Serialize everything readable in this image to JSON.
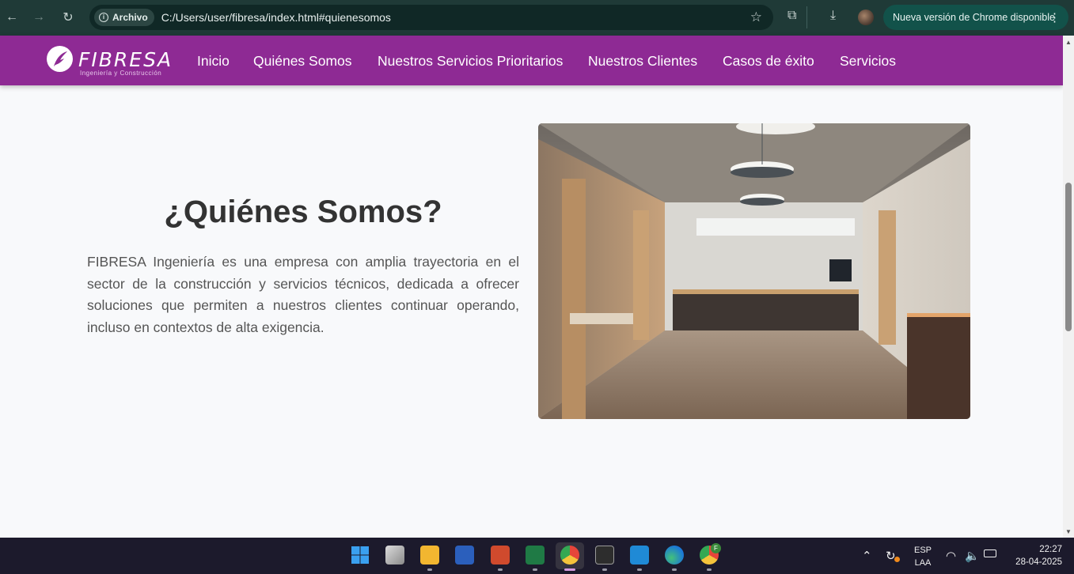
{
  "browser": {
    "site_chip": "Archivo",
    "url": "C:/Users/user/fibresa/index.html#quienesomos",
    "update_label": "Nueva versión de Chrome disponible"
  },
  "site": {
    "logo_word": "FIBRESA",
    "logo_sub": "Ingeniería y Construcción",
    "nav": [
      "Inicio",
      "Quiénes Somos",
      "Nuestros Servicios Prioritarios",
      "Nuestros Clientes",
      "Casos de éxito",
      "Servicios"
    ]
  },
  "about": {
    "heading": "¿Quiénes Somos?",
    "text": "FIBRESA Ingeniería es una empresa con amplia trayectoria en el sector de la construcción y servicios técnicos, dedicada a ofrecer soluciones que permiten a nuestros clientes continuar operando, incluso en contextos de alta exigencia."
  },
  "taskbar": {
    "language_top": "ESP",
    "language_bottom": "LAA",
    "time": "22:27",
    "date": "28-04-2025",
    "chrome_profile_badge": "F"
  },
  "colors": {
    "nav_bg": "#8e2a94",
    "chrome_bar": "#1f3a37",
    "update_pill": "#12524a"
  }
}
